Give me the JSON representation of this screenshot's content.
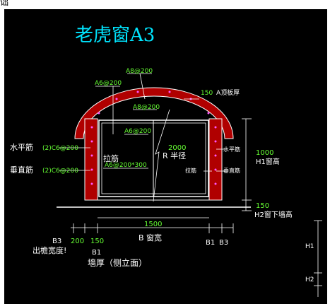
{
  "title": "老虎窗A3",
  "top_glyph": "诎",
  "colors": {
    "background": "#000000",
    "title": "#00e5ff",
    "dim": "#ffffff",
    "green_label": "#66ff33",
    "wall_fill": "#b00000",
    "rebar": "#ff55ff",
    "frame": "#ffffff"
  },
  "labels": {
    "top_rebar": "A8@200",
    "inner_arch_rebar": "A6@200",
    "mid_arch_rebar": "A8@200",
    "inner_rebar_2": "A6@200",
    "roof_thickness_value": "150",
    "roof_thickness_label": "A顶板厚",
    "horizontal_bar": "水平筋",
    "horizontal_bar_spec": "(2)C6@200",
    "vertical_bar": "垂直筋",
    "vertical_bar_spec": "(2)C6@200",
    "tie_bar": "拉筋",
    "tie_bar_spec": "A6@200*300",
    "radius_value": "2000",
    "radius_label": "R 半径",
    "right_horizontal_bar": "水平筋",
    "right_tie_bar": "拉筋",
    "right_vertical_bar": "垂直筋",
    "window_height_value": "1000",
    "window_height_label": "H1窗高",
    "sill_value": "150",
    "sill_label": "H2窗下墙高",
    "width_value": "1500",
    "width_label": "B 窗宽",
    "b3_left": "B3",
    "dim_200": "200",
    "dim_150": "150",
    "b1_left": "B1",
    "eave_label": "出檐宽度!",
    "wall_thickness_label": "墙厚（侧立面）",
    "b1_right": "B1",
    "b3_right": "B3",
    "h1": "H1",
    "h2": "H2"
  }
}
